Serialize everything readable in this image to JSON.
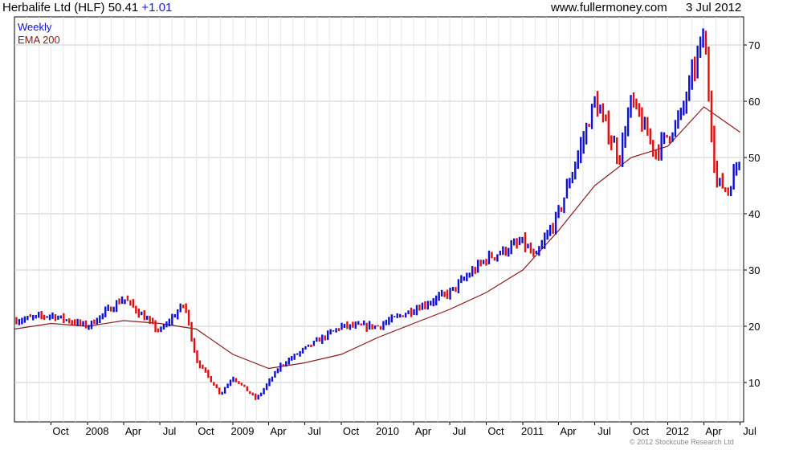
{
  "header": {
    "ticker": "Herbalife Ltd (HLF) 50.41",
    "change": "+1.01",
    "site": "www.fullermoney.com",
    "date": "3 Jul 2012"
  },
  "footer": {
    "copyright": "© 2012 Stockcube Research Ltd"
  },
  "colors": {
    "up": "#1010d0",
    "down": "#e01010",
    "ema": "#8b1a1a",
    "grid": "#cccccc"
  },
  "chart_data": {
    "type": "line",
    "title": "Herbalife Ltd (HLF) 50.41 +1.01",
    "xlabel": "",
    "ylabel": "",
    "ylim": [
      3,
      75
    ],
    "yticks": [
      10,
      20,
      30,
      40,
      50,
      60,
      70
    ],
    "ytick_labels": [
      "10",
      "20",
      "30",
      "40",
      "50",
      "60",
      "70"
    ],
    "xtick_labels": [
      "Oct",
      "2008",
      "Apr",
      "Jul",
      "Oct",
      "2009",
      "Apr",
      "Jul",
      "Oct",
      "2010",
      "Apr",
      "Jul",
      "Oct",
      "2011",
      "Apr",
      "Jul",
      "Oct",
      "2012",
      "Apr",
      "Jul"
    ],
    "grid": true,
    "legend_position": "top-left",
    "series": [
      {
        "name": "Weekly",
        "style": "weekly-bars",
        "x": [
          "2007-07",
          "2007-10",
          "2008-01",
          "2008-04",
          "2008-07",
          "2008-09",
          "2008-10",
          "2008-12",
          "2009-01",
          "2009-03",
          "2009-05",
          "2009-07",
          "2009-10",
          "2010-01",
          "2010-04",
          "2010-07",
          "2010-10",
          "2011-01",
          "2011-02",
          "2011-04",
          "2011-06",
          "2011-07",
          "2011-09",
          "2011-10",
          "2011-12",
          "2012-02",
          "2012-04",
          "2012-05",
          "2012-06",
          "2012-07"
        ],
        "values": [
          21,
          22,
          20,
          25,
          19,
          24,
          14,
          8,
          11,
          7,
          13,
          16,
          20,
          20,
          23,
          26,
          32,
          35,
          32,
          40,
          53,
          60,
          50,
          60,
          51,
          57,
          72,
          46,
          44,
          50.4
        ]
      },
      {
        "name": "EMA 200",
        "style": "line",
        "x": [
          "2007-07",
          "2007-10",
          "2008-01",
          "2008-04",
          "2008-07",
          "2008-10",
          "2009-01",
          "2009-04",
          "2009-07",
          "2009-10",
          "2010-01",
          "2010-04",
          "2010-07",
          "2010-10",
          "2011-01",
          "2011-04",
          "2011-07",
          "2011-10",
          "2012-01",
          "2012-04",
          "2012-07"
        ],
        "values": [
          19.5,
          20.5,
          20,
          21,
          20.5,
          19.5,
          15,
          12.5,
          13.5,
          15,
          18,
          20.5,
          23,
          26,
          30,
          37,
          45,
          50,
          52,
          59,
          54.5
        ]
      }
    ]
  }
}
